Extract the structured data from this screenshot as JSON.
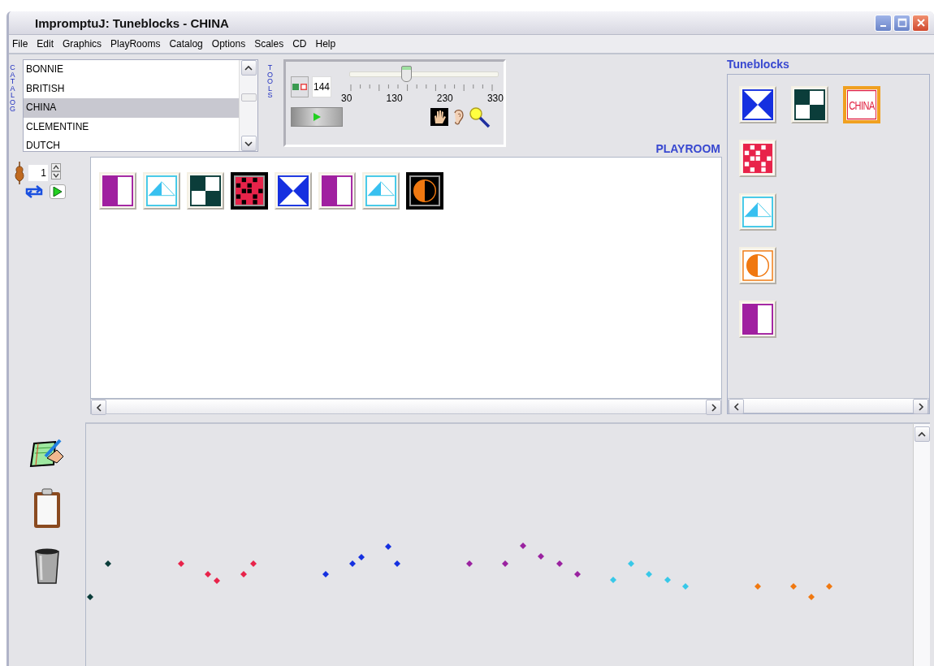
{
  "window": {
    "title": "ImpromptuJ: Tuneblocks - CHINA"
  },
  "menu": [
    "File",
    "Edit",
    "Graphics",
    "PlayRooms",
    "Catalog",
    "Options",
    "Scales",
    "CD",
    "Help"
  ],
  "catalog": {
    "label": "CATALOG",
    "items": [
      {
        "name": "BONNIE",
        "selected": false
      },
      {
        "name": "BRITISH",
        "selected": false
      },
      {
        "name": "CHINA",
        "selected": true
      },
      {
        "name": "CLEMENTINE",
        "selected": false
      },
      {
        "name": "DUTCH",
        "selected": false
      }
    ]
  },
  "tools": {
    "label": "TOOLS",
    "tempo": "144",
    "level": 0.38,
    "ticks": [
      "30",
      "130",
      "230",
      "330"
    ]
  },
  "playroom": {
    "label": "PLAYROOM",
    "voice": "1",
    "blocks": [
      {
        "kind": "purple",
        "highlighted": false
      },
      {
        "kind": "cyan",
        "highlighted": false
      },
      {
        "kind": "checker",
        "highlighted": false
      },
      {
        "kind": "grid",
        "highlighted": true
      },
      {
        "kind": "hourglass",
        "highlighted": false
      },
      {
        "kind": "purple",
        "highlighted": false
      },
      {
        "kind": "cyan",
        "highlighted": false
      },
      {
        "kind": "orange",
        "highlighted": true
      }
    ]
  },
  "tuneblocks": {
    "label": "Tuneblocks",
    "blocks": [
      {
        "kind": "hourglass",
        "selected": false
      },
      {
        "kind": "checker",
        "selected": false
      },
      {
        "kind": "label",
        "text": "CHINA",
        "selected": true
      },
      {
        "kind": "grid",
        "selected": false
      },
      {
        "kind": "cyan",
        "selected": false
      },
      {
        "kind": "orange",
        "selected": false
      },
      {
        "kind": "purple",
        "selected": false
      }
    ]
  }
}
